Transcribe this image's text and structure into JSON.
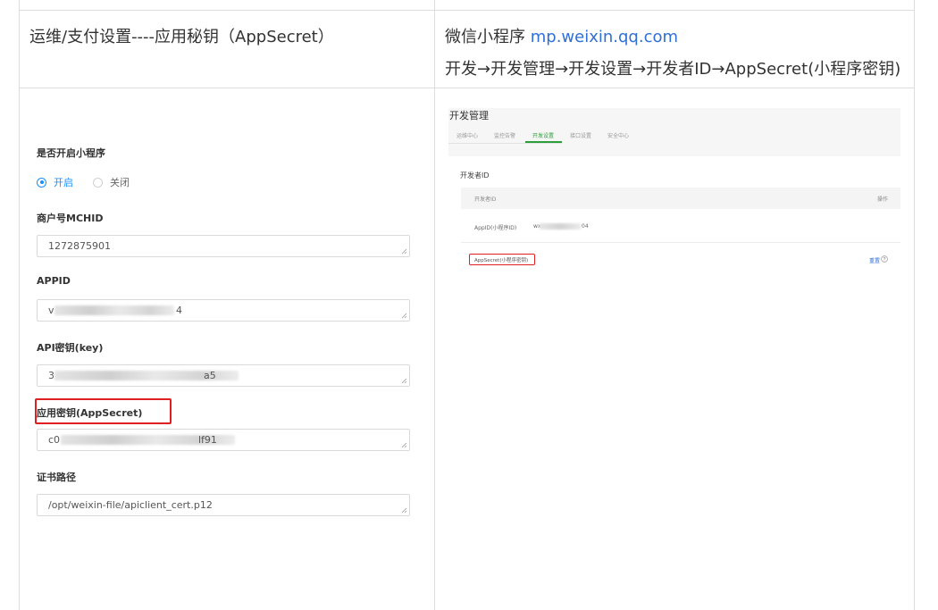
{
  "row1": {
    "left_text": "运维/支付设置----应用秘钥（AppSecret）",
    "right_prefix": "微信小程序 ",
    "right_link": "mp.weixin.qq.com",
    "right_path": "开发→开发管理→开发设置→开发者ID→AppSecret(小程序密钥)"
  },
  "left_form": {
    "enable_label": "是否开启小程序",
    "radio_on": "开启",
    "radio_off": "关闭",
    "mchid_label": "商户号MCHID",
    "mchid_value": "1272875901",
    "appid_label": "APPID",
    "appid_prefix": "v",
    "appid_suffix": "4",
    "apikey_label": "API密钥(key)",
    "apikey_prefix": "3",
    "apikey_suffix": "a5",
    "appsecret_label": "应用密钥(AppSecret)",
    "appsecret_prefix": "c0",
    "appsecret_suffix": "lf91",
    "cert_label": "证书路径",
    "cert_value": "/opt/weixin-file/apiclient_cert.p12"
  },
  "right_shot": {
    "title": "开发管理",
    "tabs": [
      "运维中心",
      "监控告警",
      "开发设置",
      "接口设置",
      "安全中心"
    ],
    "active_tab": "开发设置",
    "section_title": "开发者ID",
    "col_id": "开发者ID",
    "col_action": "操作",
    "appid_row_label": "AppID(小程序ID)",
    "appid_row_prefix": "wx",
    "appid_row_suffix": "04",
    "secret_row_label": "AppSecret(小程序密钥)",
    "secret_row_action": "重置",
    "help_icon": "question-circle-icon"
  },
  "colors": {
    "accent_blue": "#1890ff",
    "link_blue": "#2f6fd8",
    "highlight_red": "#e02020",
    "wechat_green": "#2e9d3b"
  }
}
